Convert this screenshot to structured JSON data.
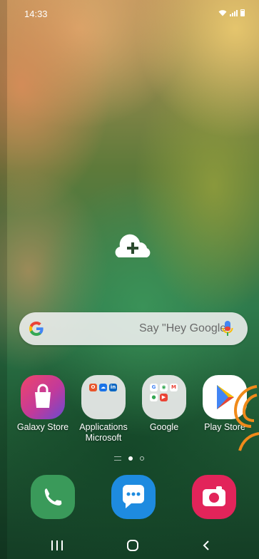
{
  "status_bar": {
    "time": "14:33",
    "icons": [
      "wifi-icon",
      "signal-icon",
      "battery-icon"
    ]
  },
  "home": {
    "add_page_icon": "cloud-plus-icon"
  },
  "search": {
    "placeholder": "Say \"Hey Google\"",
    "logo": "google-g-icon",
    "mic": "mic-icon"
  },
  "apps": [
    {
      "label": "Galaxy Store",
      "icon": "galaxy-store-icon"
    },
    {
      "label": "Applications Microsoft",
      "icon": "microsoft-folder-icon"
    },
    {
      "label": "Google",
      "icon": "google-folder-icon"
    },
    {
      "label": "Play Store",
      "icon": "play-store-icon"
    }
  ],
  "page_indicator": {
    "pages": 2,
    "current": 1
  },
  "dock": [
    {
      "icon": "phone-icon"
    },
    {
      "icon": "messages-icon"
    },
    {
      "icon": "camera-icon"
    }
  ],
  "nav": [
    "recents-button",
    "home-button",
    "back-button"
  ],
  "colors": {
    "google_blue": "#4285F4",
    "google_red": "#EA4335",
    "google_yellow": "#FBBC05",
    "google_green": "#34A853",
    "touch_indicator": "#f08a1a"
  }
}
